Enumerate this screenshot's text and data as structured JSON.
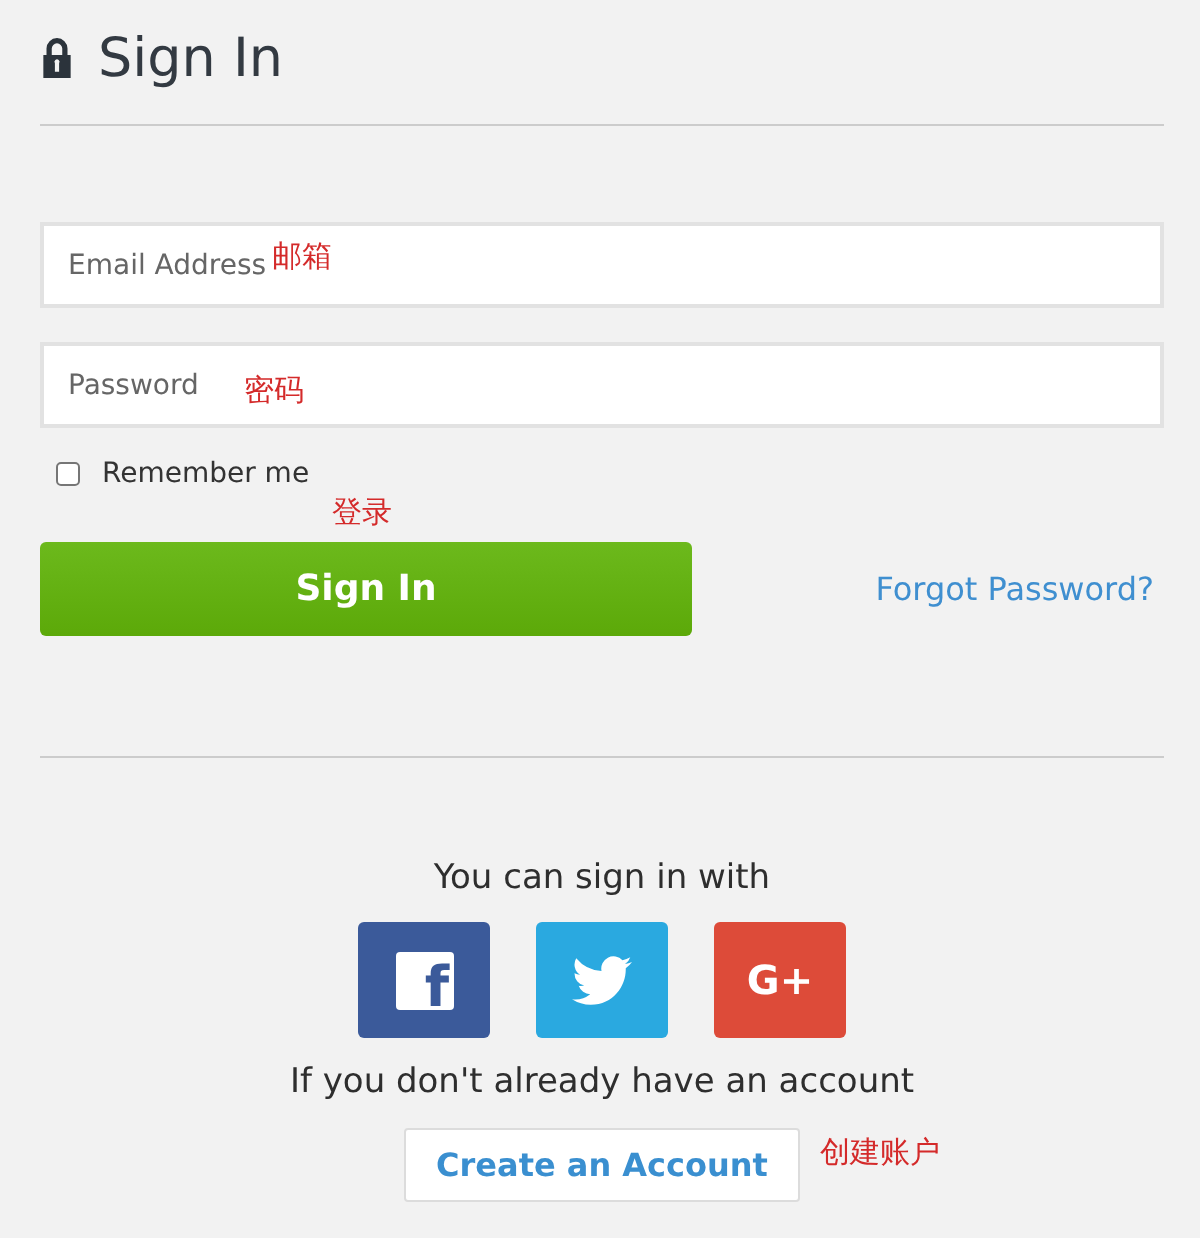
{
  "title": "Sign In",
  "fields": [
    {
      "placeholder": "Email Address",
      "note": "邮箱"
    },
    {
      "placeholder": "Password",
      "note": "密码"
    }
  ],
  "remember": {
    "label": "Remember me",
    "checked": false
  },
  "submit": {
    "label": "Sign In",
    "note": "登录"
  },
  "forgot_link": "Forgot Password?",
  "social_prompt": "You can sign in with",
  "social_buttons": [
    {
      "kind": "facebook",
      "label": "f"
    },
    {
      "kind": "twitter"
    },
    {
      "kind": "google",
      "label": "G+"
    }
  ],
  "signup_prompt": "If you don't already have an account",
  "create_account": {
    "label": "Create an Account",
    "note": "创建账户"
  }
}
